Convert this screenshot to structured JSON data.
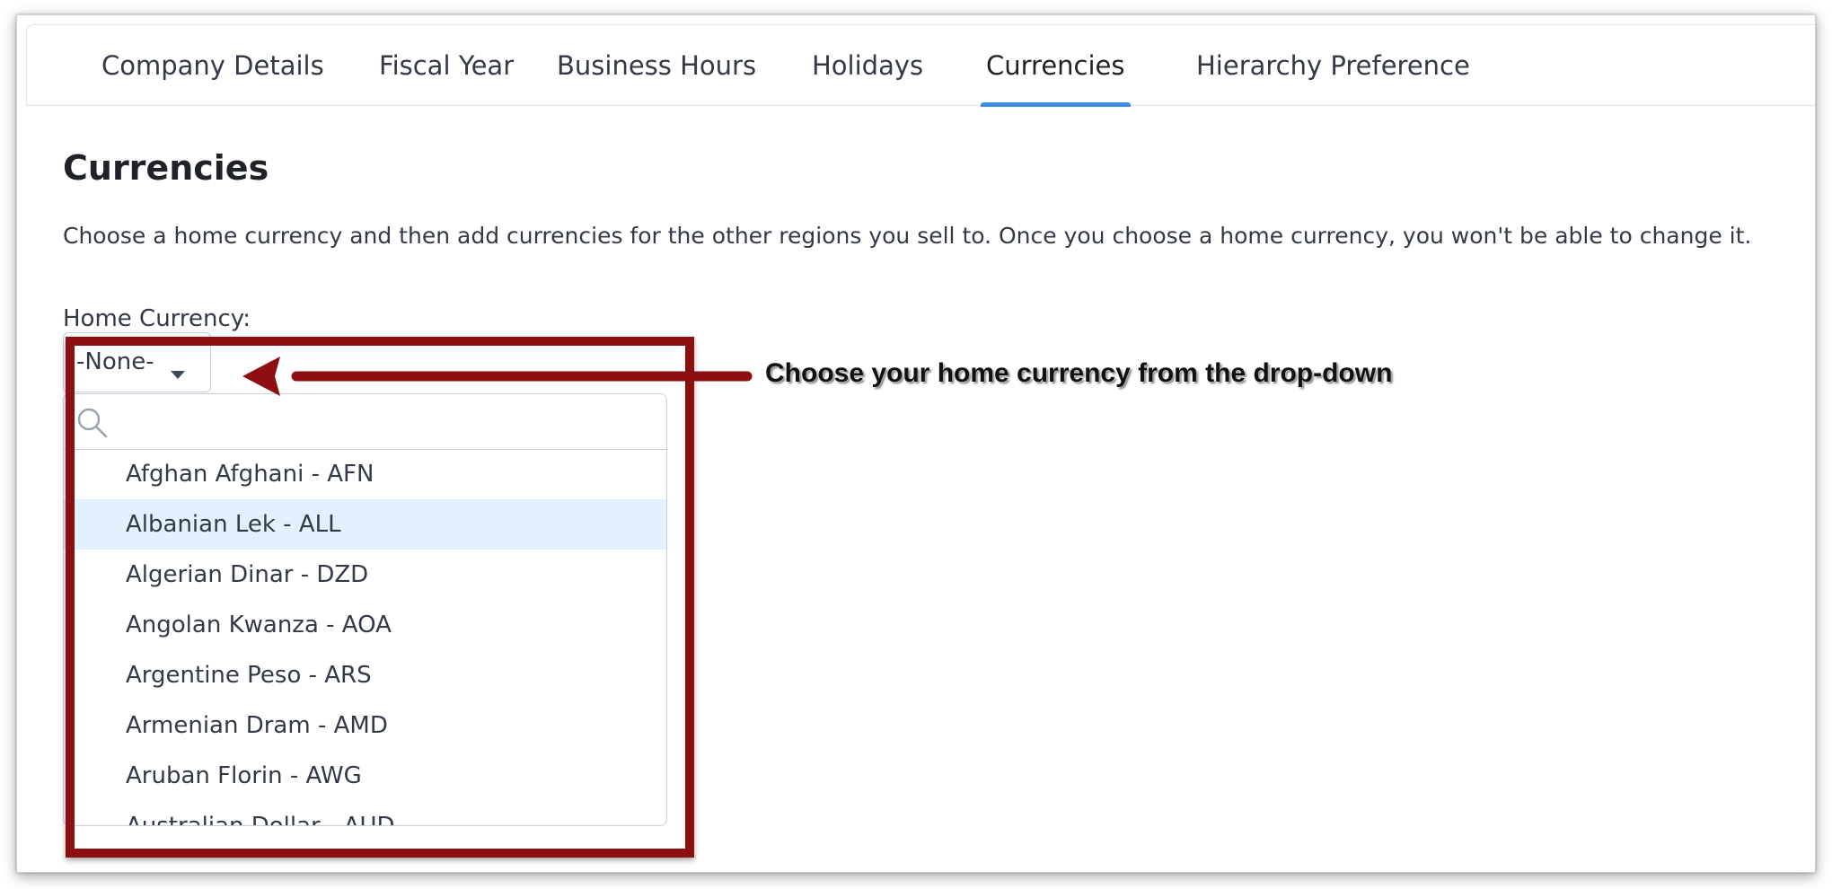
{
  "tabs": [
    {
      "label": "Company Details"
    },
    {
      "label": "Fiscal Year"
    },
    {
      "label": "Business Hours"
    },
    {
      "label": "Holidays"
    },
    {
      "label": "Currencies",
      "active": true
    },
    {
      "label": "Hierarchy Preference"
    }
  ],
  "page": {
    "title": "Currencies",
    "description": "Choose a home currency and then add currencies for the other regions you sell to. Once you choose a home currency, you won't be able to change it.",
    "home_currency_label": "Home Currency:"
  },
  "select": {
    "value": "-None-",
    "search_placeholder": ""
  },
  "options": [
    {
      "label": "Afghan Afghani - AFN"
    },
    {
      "label": "Albanian Lek - ALL",
      "highlighted": true
    },
    {
      "label": "Algerian Dinar - DZD"
    },
    {
      "label": "Angolan Kwanza - AOA"
    },
    {
      "label": "Argentine Peso - ARS"
    },
    {
      "label": "Armenian Dram - AMD"
    },
    {
      "label": "Aruban Florin - AWG"
    },
    {
      "label": "Australian Dollar - AUD"
    }
  ],
  "annotation": {
    "text": "Choose your home currency from the drop-down",
    "color": "#8e0f12"
  },
  "colors": {
    "active_tab_underline": "#3b8de3",
    "highlighted_option": "#e3f0fd"
  }
}
